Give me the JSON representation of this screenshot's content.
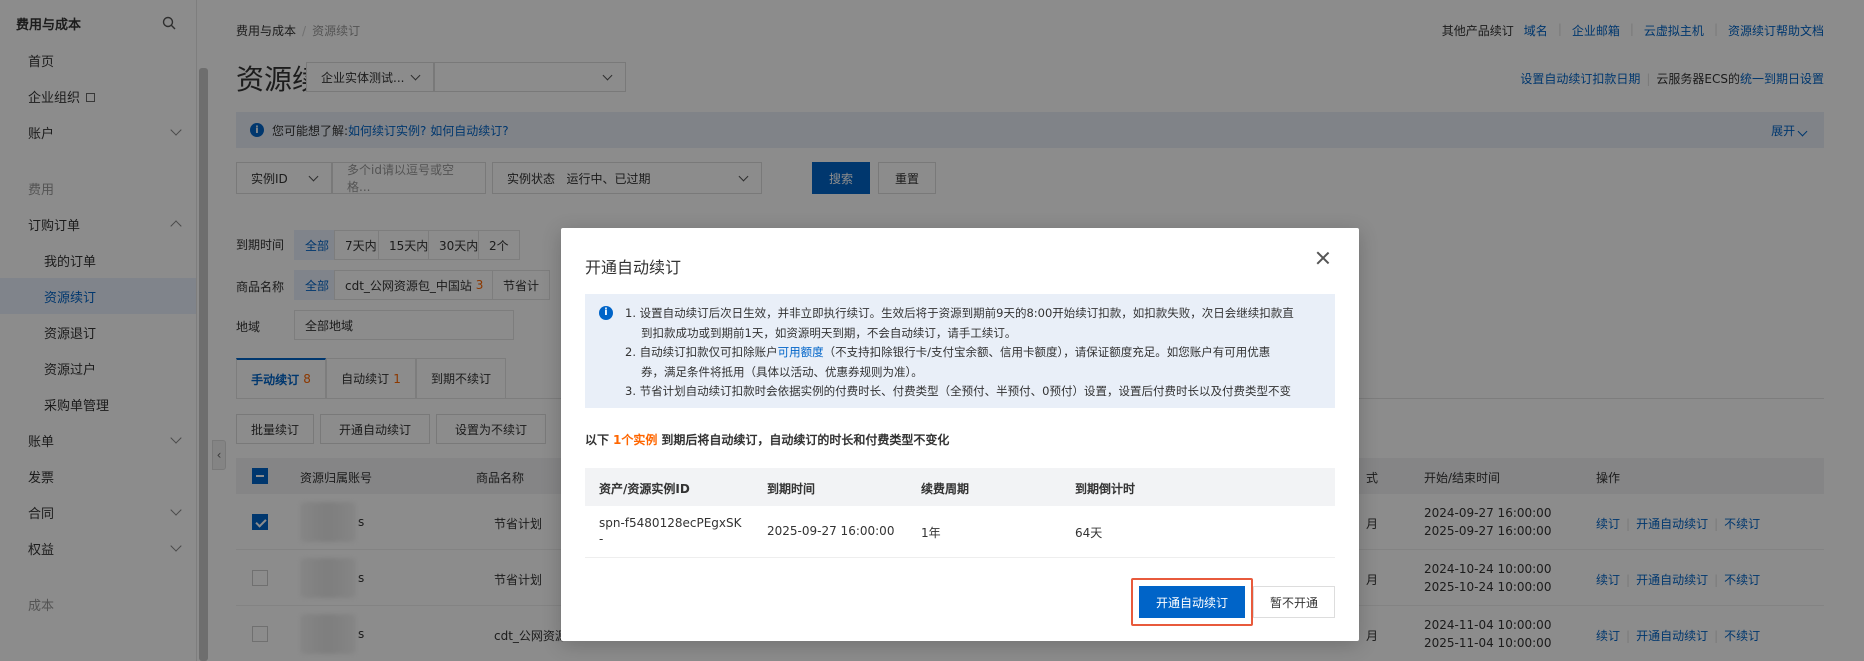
{
  "sidebar": {
    "title": "费用与成本",
    "items": [
      {
        "label": "首页"
      },
      {
        "label": "企业组织"
      },
      {
        "label": "账户"
      },
      {
        "label": "费用"
      },
      {
        "label": "订购订单"
      },
      {
        "label": "我的订单"
      },
      {
        "label": "资源续订"
      },
      {
        "label": "资源退订"
      },
      {
        "label": "资源过户"
      },
      {
        "label": "采购单管理"
      },
      {
        "label": "账单"
      },
      {
        "label": "发票"
      },
      {
        "label": "合同"
      },
      {
        "label": "权益"
      },
      {
        "label": "成本"
      }
    ]
  },
  "breadcrumb": {
    "root": "费用与成本",
    "current": "资源续订"
  },
  "toplinks": {
    "other_label": "其他产品续订",
    "domain": "域名",
    "mail": "企业邮箱",
    "vhost": "云虚拟主机",
    "help": "资源续订帮助文档"
  },
  "page_title": "资源续订",
  "entity_select": "企业实体测试...",
  "account_select": "",
  "right_links": {
    "autodate": "设置自动续订扣款日期",
    "ecs_prefix": "云服务器ECS的",
    "ecs_link": "统一到期日设置"
  },
  "infobar": {
    "icon": "i",
    "text": "您可能想了解:",
    "link": "如何续订实例? 如何自动续订?",
    "expand": "展开"
  },
  "filters": {
    "id_type": "实例ID",
    "id_placeholder": "多个id请以逗号或空格...",
    "status_label": "实例状态",
    "status_value": "运行中、已过期",
    "search": "搜索",
    "reset": "重置"
  },
  "expiry": {
    "label": "到期时间",
    "options": [
      "全部",
      "7天内",
      "15天内",
      "30天内",
      "2个"
    ]
  },
  "product": {
    "label": "商品名称",
    "options": [
      "全部",
      "cdt_公网资源包_中国站",
      "节省计"
    ],
    "count": "3"
  },
  "region": {
    "label": "地域",
    "value": "全部地域"
  },
  "tabs": [
    {
      "label": "手动续订",
      "count": "8"
    },
    {
      "label": "自动续订",
      "count": "1"
    },
    {
      "label": "到期不续订",
      "count": ""
    }
  ],
  "actions": {
    "batch": "批量续订",
    "enable_auto": "开通自动续订",
    "set_no_renew": "设置为不续订"
  },
  "table": {
    "headers": [
      "资源归属账号",
      "商品名称",
      "式",
      "开始/结束时间",
      "操作"
    ],
    "rows": [
      {
        "account_tail": "s",
        "product": "节省计划",
        "mode": "月",
        "start": "2024-09-27 16:00:00",
        "end": "2025-09-27 16:00:00"
      },
      {
        "account_tail": "s",
        "product": "节省计划",
        "mode": "月",
        "start": "2024-10-24 10:00:00",
        "end": "2025-10-24 10:00:00"
      },
      {
        "account_tail": "s",
        "product": "cdt_公网资源",
        "mode": "月",
        "start": "2024-11-04 10:00:00",
        "end": "2025-11-04 10:00:00"
      }
    ],
    "row_actions": [
      "续订",
      "开通自动续订",
      "不续订"
    ]
  },
  "modal": {
    "title": "开通自动续订",
    "notice": {
      "icon": "i",
      "l1a": "1. 设置自动续订后次日生效，并非立即执行续订。生效后将于资源到期前9天的8:00开始续订扣款，如扣款失败，次日会继续扣款直",
      "l1b": "到扣款成功或到期前1天，如资源明天到期，不会自动续订，请手工续订。",
      "l2a_pre": "2. 自动续订扣款仅可扣除账户",
      "l2a_link": "可用额度",
      "l2a_post": "（不支持扣除银行卡/支付宝余额、信用卡额度），请保证额度充足。如您账户有可用优惠",
      "l2b": "券，满足条件将抵用（具体以活动、优惠券规则为准）。",
      "l3": "3. 节省计划自动续订扣款时会依据实例的付费时长、付费类型（全预付、半预付、0预付）设置，设置后付费时长以及付费类型不变"
    },
    "summary_pre": "以下",
    "summary_count": "1个实例",
    "summary_post": "到期后将自动续订，自动续订的时长和付费类型不变化",
    "table": {
      "headers": [
        "资产/资源实例ID",
        "到期时间",
        "续费周期",
        "到期倒计时"
      ],
      "row": {
        "id": "spn-f5480128ecPEgxSK",
        "id2": "-",
        "expire": "2025-09-27 16:00:00",
        "period": "1年",
        "countdown": "64天"
      }
    },
    "confirm": "开通自动续订",
    "cancel": "暂不开通"
  },
  "colors": {
    "primary": "#0064c8",
    "accent": "#ff6600",
    "highlight": "#e85a3c"
  }
}
